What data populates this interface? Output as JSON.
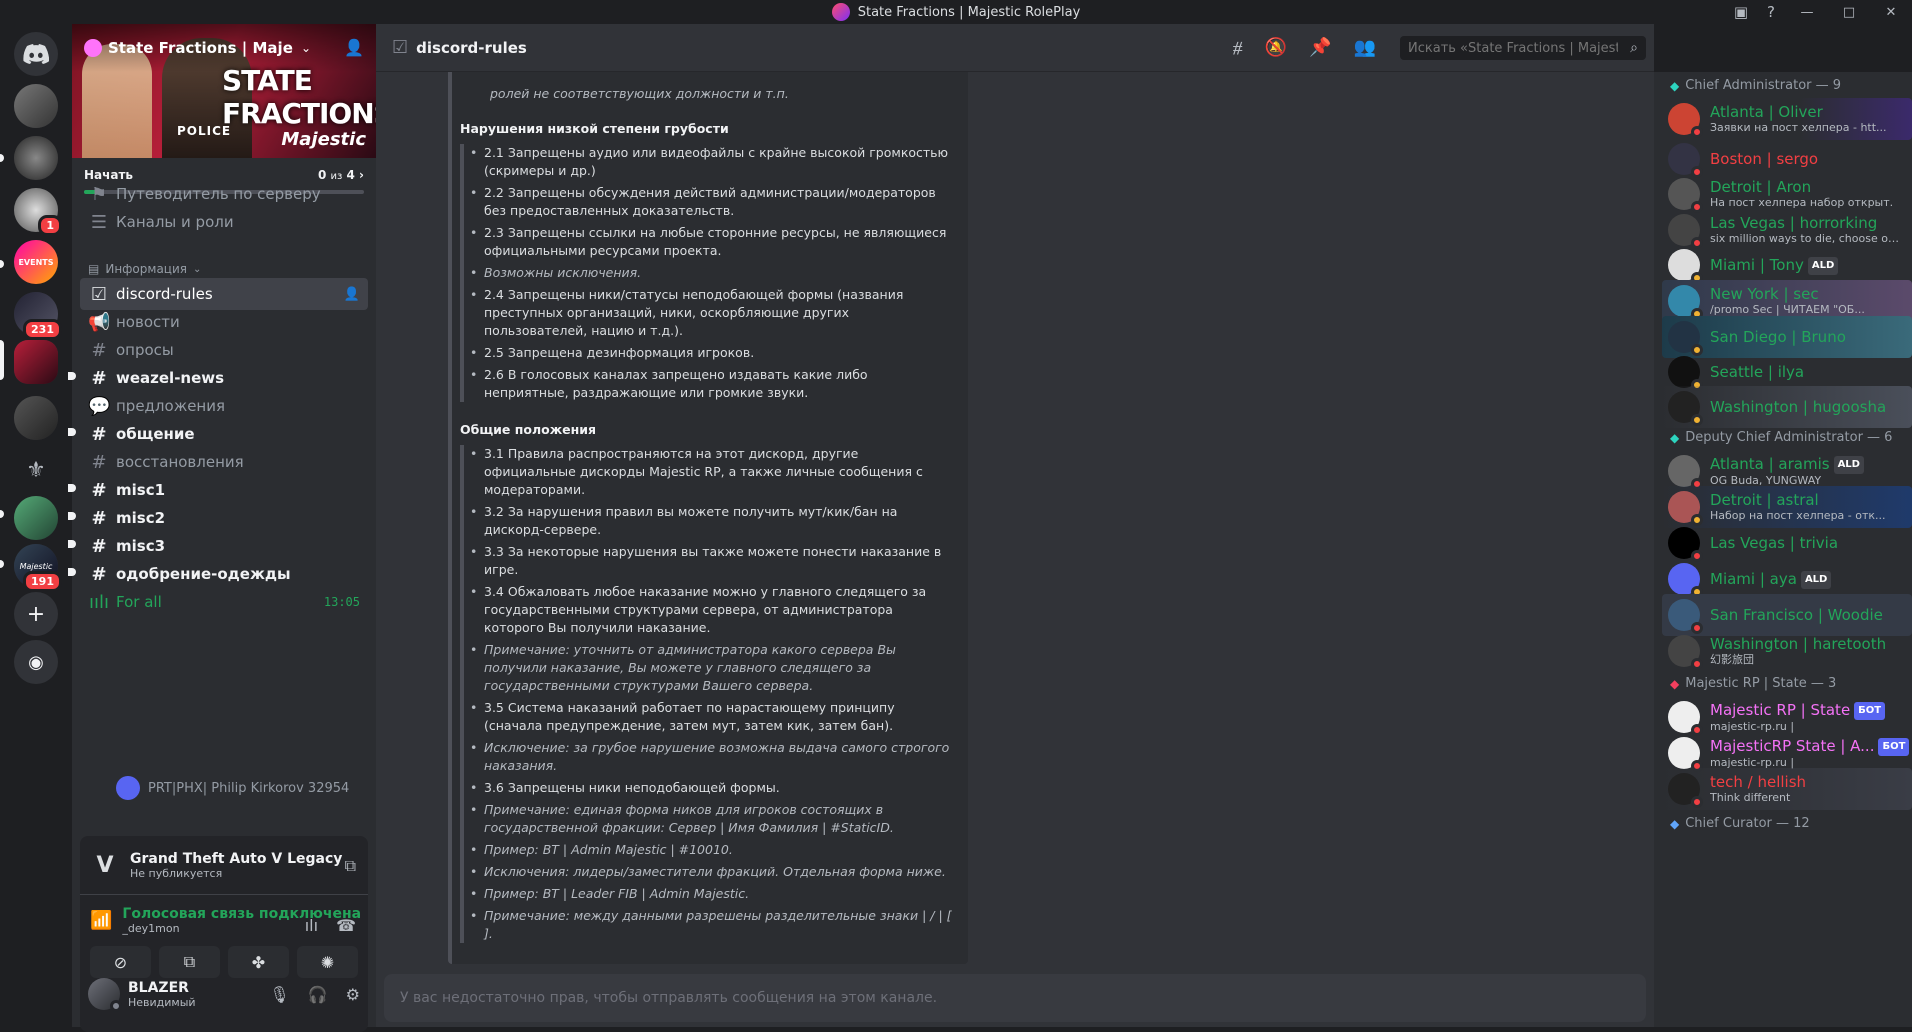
{
  "window": {
    "title": "State Fractions | Majestic RolePlay"
  },
  "servers": [
    {
      "id": "home",
      "icon": "discord-icon"
    },
    {
      "id": "s1",
      "badge": ""
    },
    {
      "id": "s2",
      "badge": ""
    },
    {
      "id": "s3",
      "badge": "1"
    },
    {
      "id": "s4",
      "badge": "",
      "label": "EVENTS"
    },
    {
      "id": "s5",
      "badge": "231"
    },
    {
      "id": "s6",
      "badge": ""
    },
    {
      "id": "s7",
      "badge": ""
    },
    {
      "id": "s8",
      "badge": ""
    },
    {
      "id": "s9",
      "badge": ""
    },
    {
      "id": "s10",
      "badge": "191",
      "label": "Majestic"
    }
  ],
  "sidebar": {
    "server_name": "State Fractions | Majesti...",
    "banner_text": "STATE FRACTIONS",
    "banner_brand": "Majestic",
    "banner_police": "POLICE",
    "progress": {
      "label": "Начать",
      "count": "0",
      "of": "из",
      "total": "4",
      "fraction": 0.05
    },
    "guide": "Путеводитель по серверу",
    "channels_roles": "Каналы и роли",
    "category": "Информация",
    "channels": [
      {
        "name": "discord-rules",
        "icon": "#"
      },
      {
        "name": "новости"
      },
      {
        "name": "опросы"
      },
      {
        "name": "weazel-news"
      },
      {
        "name": "предложения"
      },
      {
        "name": "общение"
      },
      {
        "name": "восстановления"
      },
      {
        "name": "misc1"
      },
      {
        "name": "misc2"
      },
      {
        "name": "misc3"
      },
      {
        "name": "одобрение-одежды"
      },
      {
        "name": "For all",
        "time": "13:05"
      }
    ],
    "voice_user": "PRT|PHX| Philip Kirkorov 32954"
  },
  "activity": {
    "game": "Grand Theft Auto V Legacy",
    "game_sub": "Не публикуется",
    "voice_title": "Голосовая связь подключена",
    "voice_sub": "_dey1mon"
  },
  "user": {
    "name": "BLAZER",
    "status": "Невидимый"
  },
  "channel": {
    "name": "discord-rules",
    "search_placeholder": "Искать «State Fractions | Majest..."
  },
  "embed": {
    "top_line": "ролей не соответствующих должности и т.п.",
    "sections": [
      {
        "title": "Нарушения низкой степени грубости",
        "rules": [
          {
            "text": "2.1 Запрещены аудио или видеофайлы с крайне высокой громкостью (скримеры и др.)",
            "italic": false
          },
          {
            "text": "2.2 Запрещены обсуждения действий администрации/модераторов без предоставленных доказательств.",
            "italic": false
          },
          {
            "text": "2.3 Запрещены ссылки на любые сторонние ресурсы, не являющиеся официальными ресурсами проекта.",
            "italic": false
          },
          {
            "text": "Возможны исключения.",
            "italic": true
          },
          {
            "text": "2.4 Запрещены ники/статусы неподобающей формы (названия преступных организаций, ники, оскорбляющие других пользователей, нацию и т.д.).",
            "italic": false
          },
          {
            "text": "2.5 Запрещена дезинформация игроков.",
            "italic": false
          },
          {
            "text": "2.6 В голосовых каналах запрещено издавать какие либо неприятные, раздражающие или громкие звуки.",
            "italic": false
          }
        ]
      },
      {
        "title": "Общие положения",
        "rules": [
          {
            "text": "3.1 Правила распространяются на этот дискорд, другие официальные дискорды Majestic RP, а также личные сообщения с модераторами.",
            "italic": false
          },
          {
            "text": "3.2 За нарушения правил вы можете получить мут/кик/бан на дискорд-сервере.",
            "italic": false
          },
          {
            "text": "3.3 За некоторые нарушения вы также можете понести наказание в игре.",
            "italic": false
          },
          {
            "text": "3.4 Обжаловать любое наказание можно у главного следящего за государственными структурами сервера, от администратора которого Вы получили наказание.",
            "italic": false
          },
          {
            "text": "Примечание: уточнить от администратора какого сервера Вы получили наказание, Вы можете у главного следящего за государственными структурами Вашего сервера.",
            "italic": true
          },
          {
            "text": "3.5 Система наказаний работает по нарастающему принципу (сначала предупреждение, затем мут, затем кик, затем бан).",
            "italic": false
          },
          {
            "text": "Исключение: за грубое нарушение возможна выдача самого строгого наказания.",
            "italic": true
          },
          {
            "text": "3.6 Запрещены ники неподобающей формы.",
            "italic": false
          },
          {
            "text": "Примечание: единая форма ников для игроков состоящих в государственной фракции: Сервер | Имя Фамилия | #StaticID.",
            "italic": true
          },
          {
            "text": "Пример: BT | Admin Majestic | #10010.",
            "italic": true
          },
          {
            "text": "Исключения: лидеры/заместители фракций. Отдельная форма ниже.",
            "italic": true
          },
          {
            "text": "Пример: BT | Leader FIB | Admin Majestic.",
            "italic": true
          },
          {
            "text": "Примечание: между данными разрешены разделительные знаки | / | [ ].",
            "italic": true
          }
        ]
      }
    ]
  },
  "composer": {
    "placeholder": "У вас недостаточно прав, чтобы отправлять сообщения на этом канале."
  },
  "members": {
    "groups": [
      {
        "title": "Chief Administrator — 9",
        "color": "#2dd4bf"
      },
      {
        "title": "Deputy Chief Administrator — 6",
        "color": "#2dd4bf"
      },
      {
        "title": "Majestic RP | State — 3",
        "color": "#f43f5e"
      },
      {
        "title": "Chief Curator — 12",
        "color": "#60a5fa"
      }
    ],
    "list": [
      {
        "name": "Atlanta | Oliver",
        "sub": "Заявки на пост хелпера - htt...",
        "color": "#23a55a",
        "tag": ""
      },
      {
        "name": "Boston | sergo",
        "sub": "",
        "color": "#f23f43",
        "tag": ""
      },
      {
        "name": "Detroit | Aron",
        "sub": "На пост хелпера набор открыт.",
        "color": "#23a55a",
        "tag": ""
      },
      {
        "name": "Las Vegas | horrorking",
        "sub": "six million ways to die, choose one",
        "color": "#23a55a",
        "tag": ""
      },
      {
        "name": "Miami | Tony",
        "sub": "",
        "color": "#23a55a",
        "tag": "ALD"
      },
      {
        "name": "New York | sec",
        "sub": "/promo Sec | ЧИТАЕМ \"ОБ...",
        "color": "#23a55a",
        "tag": ""
      },
      {
        "name": "San Diego | Bruno",
        "sub": "",
        "color": "#23a55a",
        "tag": ""
      },
      {
        "name": "Seattle | ilya",
        "sub": "",
        "color": "#23a55a",
        "tag": ""
      },
      {
        "name": "Washington | hugoosha",
        "sub": "",
        "color": "#23a55a",
        "tag": ""
      },
      {
        "name": "Atlanta | aramis",
        "sub": "OG Buda, YUNGWAY",
        "color": "#23a55a",
        "tag": "ALD"
      },
      {
        "name": "Detroit | astral",
        "sub": "Набор на пост хелпера - отк...",
        "color": "#23a55a",
        "tag": ""
      },
      {
        "name": "Las Vegas | trivia",
        "sub": "",
        "color": "#23a55a",
        "tag": ""
      },
      {
        "name": "Miami | aya",
        "sub": "",
        "color": "#23a55a",
        "tag": "ALD"
      },
      {
        "name": "San Francisco | Woodie",
        "sub": "",
        "color": "#23a55a",
        "tag": ""
      },
      {
        "name": "Washington | haretooth",
        "sub": "幻影旅団",
        "color": "#23a55a",
        "tag": ""
      },
      {
        "name": "Majestic RP | State",
        "sub": "majestic-rp.ru |",
        "color": "#f472f6",
        "tag": "БОТ"
      },
      {
        "name": "MajesticRP State | A...",
        "sub": "majestic-rp.ru |",
        "color": "#f472f6",
        "tag": "БОТ"
      },
      {
        "name": "tech / hellish",
        "sub": "Think different",
        "color": "#f23f43",
        "tag": ""
      }
    ]
  }
}
